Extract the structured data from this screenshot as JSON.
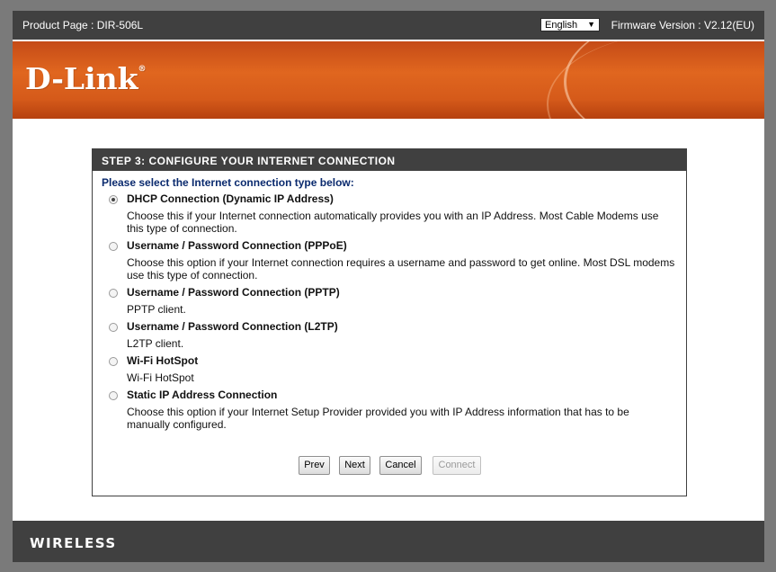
{
  "header": {
    "product_label": "Product Page :",
    "product_value": "DIR-506L",
    "language": "English",
    "firmware": "Firmware Version : V2.12(EU)"
  },
  "banner": {
    "logo": "D-Link",
    "registered": "®"
  },
  "wizard": {
    "title": "STEP 3: CONFIGURE YOUR INTERNET CONNECTION",
    "prompt": "Please select the Internet connection type below:",
    "options": [
      {
        "title": "DHCP Connection (Dynamic IP Address)",
        "desc": "Choose this if your Internet connection automatically provides you with an IP Address. Most Cable Modems use this type of connection.",
        "checked": true
      },
      {
        "title": "Username / Password Connection (PPPoE)",
        "desc": "Choose this option if your Internet connection requires a username and password to get online. Most DSL modems use this type of connection.",
        "checked": false
      },
      {
        "title": "Username / Password Connection (PPTP)",
        "desc": "PPTP client.",
        "checked": false
      },
      {
        "title": "Username / Password Connection (L2TP)",
        "desc": "L2TP client.",
        "checked": false
      },
      {
        "title": "Wi-Fi HotSpot",
        "desc": "Wi-Fi HotSpot",
        "checked": false
      },
      {
        "title": "Static IP Address Connection",
        "desc": "Choose this option if your Internet Setup Provider provided you with IP Address information that has to be manually configured.",
        "checked": false
      }
    ],
    "buttons": {
      "prev": "Prev",
      "next": "Next",
      "cancel": "Cancel",
      "connect": "Connect"
    }
  },
  "footer": {
    "brand": "WIRELESS"
  },
  "colors": {
    "banner": "#e0661f",
    "bar": "#404040",
    "prompt": "#0a2a6e"
  }
}
